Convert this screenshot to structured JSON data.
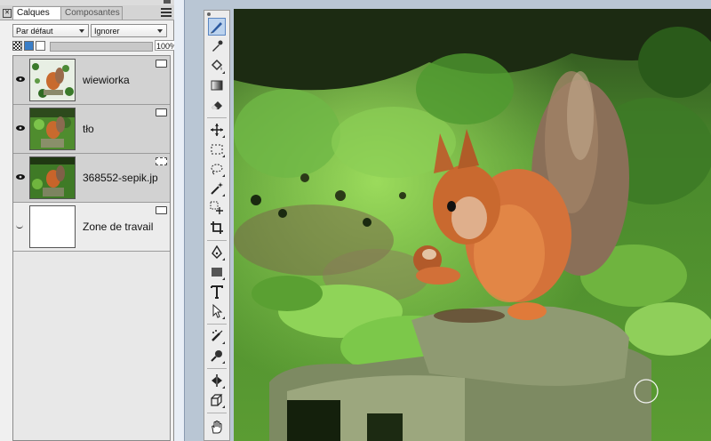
{
  "panel": {
    "tabs": {
      "layers": "Calques",
      "components": "Composantes"
    },
    "blend_mode": "Par défaut",
    "layer_mode": "Ignorer",
    "opacity": "100%",
    "layers": [
      {
        "name": "wiewiorka",
        "visible": true
      },
      {
        "name": "tło",
        "visible": true
      },
      {
        "name": "368552-sepik.jp",
        "visible": true
      },
      {
        "name": "Zone de travail",
        "visible": false
      }
    ]
  },
  "toolbar": {
    "tools": [
      "brush-tool",
      "eyedropper-tool",
      "fill-tool",
      "gradient-tool",
      "eraser-tool",
      "transform-tool",
      "marquee-tool",
      "lasso-tool",
      "magic-wand-tool",
      "select-move-tool",
      "crop-tool",
      "pen-tool",
      "shape-tool",
      "text-tool",
      "direct-select-tool",
      "clone-tool",
      "dodge-tool",
      "mirror-tool",
      "perspective-tool",
      "hand-tool"
    ],
    "active": "brush-tool"
  },
  "colors": {
    "panel": "#f0f0f0",
    "layer_selected": "#d2d2d2",
    "accent": "#3a7ec7"
  }
}
